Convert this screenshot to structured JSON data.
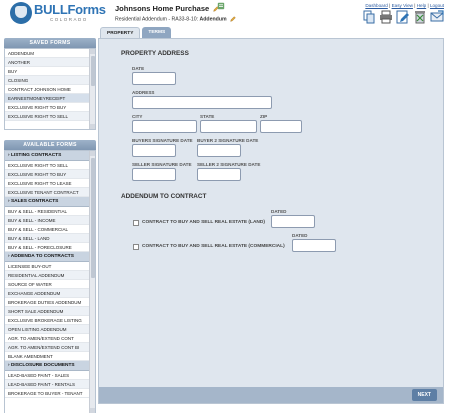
{
  "brand": {
    "name": "BULLForms",
    "tagline": "COLORADO"
  },
  "document": {
    "title": "Johnsons Home Purchase",
    "subtitle_prefix": "Residential Addendum - RA33-8-10:",
    "subtitle_form": "Addendum"
  },
  "toplinks": {
    "dashboard": "Dashboard",
    "sep1": "|",
    "easy_view": "Easy View",
    "sep2": "|",
    "help": "Help",
    "sep3": "|",
    "logout": "Logout"
  },
  "toolbar": [
    "copy-icon",
    "print-icon",
    "edit-icon",
    "delete-icon",
    "email-icon"
  ],
  "saved_forms": {
    "header": "SAVED FORMS",
    "items": [
      "ADDENDUM",
      "ANOTHER",
      "BUY",
      "CLOSING",
      "CONTRACT JOHNSON HOME",
      "EARNESTMONEYRECEIPT",
      "EXCLUSIVE RIGHT TO BUY",
      "EXCLUSIVE RIGHT TO SELL"
    ]
  },
  "available_forms": {
    "header": "AVAILABLE FORMS",
    "groups": [
      {
        "title": "LISTING CONTRACTS",
        "items": [
          "EXCLUSIVE RIGHT TO SELL",
          "EXCLUSIVE RIGHT TO BUY",
          "EXCLUSIVE RIGHT TO LEASE",
          "EXCLUSIVE TENANT CONTRACT"
        ]
      },
      {
        "title": "SALES CONTRACTS",
        "items": [
          "BUY & SELL - RESIDENTIAL",
          "BUY & SELL - INCOME",
          "BUY & SELL - COMMERCIAL",
          "BUY & SELL - LAND",
          "BUY & SELL - FORECLOSURE"
        ]
      },
      {
        "title": "ADDENDA TO CONTRACTS",
        "items": [
          "LICENSEE BUY-OUT",
          "RESIDENTIAL ADDENDUM",
          "SOURCE OF WATER",
          "EXCHANGE ADDENDUM",
          "BROKERAGE DUTIES ADDENDUM",
          "SHORT SALE ADDENDUM",
          "EXCLUSIVE BROKERAGE LISTING",
          "OPEN LISTING ADDENDUM",
          "AGR. TO AMEN/EXTEND CONT",
          "AGR. TO AMEN/EXTEND CONT BI",
          "BLANK AMENDMENT"
        ]
      },
      {
        "title": "DISCLOSURE DOCUMENTS",
        "items": [
          "LEAD-BASED PAINT - SALES",
          "LEAD-BASED PAINT - RENTALS",
          "BROKERAGE TO BUYER - TENANT"
        ]
      }
    ]
  },
  "tabs": [
    "PROPERTY",
    "TERMS"
  ],
  "property": {
    "heading": "PROPERTY ADDRESS",
    "date_label": "DATE",
    "address_label": "ADDRESS",
    "city_label": "CITY",
    "state_label": "STATE",
    "zip_label": "ZIP",
    "buyers_sig_date_label": "BUYERS SIGNATURE DATE",
    "buyer2_sig_date_label": "BUYER 2 SIGNATURE DATE",
    "seller_sig_date_label": "SELLER SIGNATURE DATE",
    "seller2_sig_date_label": "SELLER 2 SIGNATURE DATE"
  },
  "addendum": {
    "heading": "ADDENDUM TO CONTRACT",
    "land_label": "CONTRACT TO BUY AND SELL REAL ESTATE (LAND)",
    "land_dated_label": "DATED",
    "commercial_label": "CONTRACT TO BUY AND SELL REAL ESTATE (COMMERCIAL)",
    "commercial_dated_label": "DATED"
  },
  "footer": {
    "next_label": "NEXT"
  }
}
